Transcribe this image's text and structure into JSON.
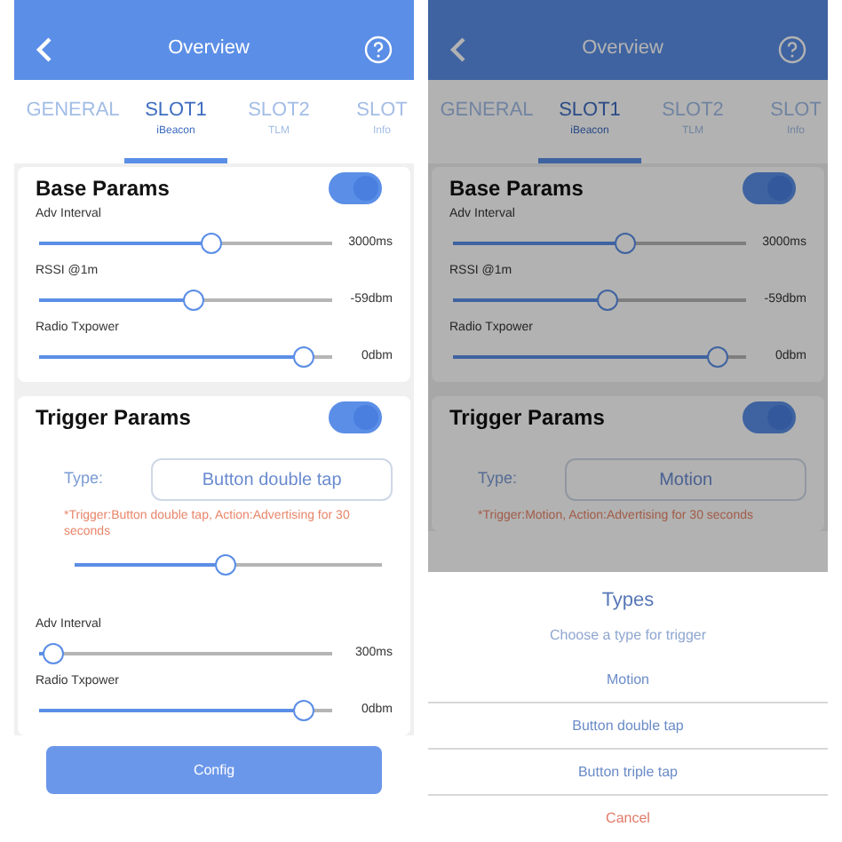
{
  "screens": [
    {
      "dimmed": false,
      "header": {
        "title": "Overview"
      },
      "tabs": [
        {
          "label": "GENERAL",
          "selected": false
        },
        {
          "label": "SLOT1",
          "sublabel": "iBeacon",
          "selected": true
        },
        {
          "label": "SLOT2",
          "sublabel": "TLM",
          "selected": false
        },
        {
          "label": "SLOT",
          "sublabel": "Info",
          "selected": false
        }
      ],
      "base_params": {
        "title": "Base Params",
        "on": true,
        "sliders": [
          {
            "label": "Adv Interval",
            "level": 0.59,
            "reading": "3000ms"
          },
          {
            "label": "RSSI @1m",
            "level": 0.53,
            "reading": "-59dbm"
          },
          {
            "label": "Radio Txpower",
            "level": 0.9,
            "reading": "0dbm"
          }
        ]
      },
      "trigger_params": {
        "title": "Trigger Params",
        "on": true,
        "type_label": "Type:",
        "type_value": "Button double tap",
        "note": "*Trigger:Button double tap, Action:Advertising for 30 seconds",
        "trigger_slider": {
          "level": 0.49
        },
        "sliders": [
          {
            "label": "Adv Interval",
            "level": 0.05,
            "reading": "300ms"
          },
          {
            "label": "Radio Txpower",
            "level": 0.9,
            "reading": "0dbm"
          }
        ]
      },
      "config_button": "Config"
    },
    {
      "dimmed": true,
      "header": {
        "title": "Overview"
      },
      "tabs": [
        {
          "label": "GENERAL",
          "selected": false
        },
        {
          "label": "SLOT1",
          "sublabel": "iBeacon",
          "selected": true
        },
        {
          "label": "SLOT2",
          "sublabel": "TLM",
          "selected": false
        },
        {
          "label": "SLOT",
          "sublabel": "Info",
          "selected": false
        }
      ],
      "base_params": {
        "title": "Base Params",
        "on": true,
        "sliders": [
          {
            "label": "Adv Interval",
            "level": 0.59,
            "reading": "3000ms"
          },
          {
            "label": "RSSI @1m",
            "level": 0.53,
            "reading": "-59dbm"
          },
          {
            "label": "Radio Txpower",
            "level": 0.9,
            "reading": "0dbm"
          }
        ]
      },
      "trigger_params": {
        "title": "Trigger Params",
        "on": true,
        "type_label": "Type:",
        "type_value": "Motion",
        "note": "*Trigger:Motion, Action:Advertising for 30 seconds"
      },
      "action_sheet": {
        "title": "Types",
        "subtitle": "Choose a type for trigger",
        "options": [
          {
            "label": "Motion",
            "kind": "option"
          },
          {
            "label": "Button double tap",
            "kind": "option"
          },
          {
            "label": "Button triple tap",
            "kind": "option"
          },
          {
            "label": "Cancel",
            "kind": "cancel"
          }
        ]
      }
    }
  ]
}
